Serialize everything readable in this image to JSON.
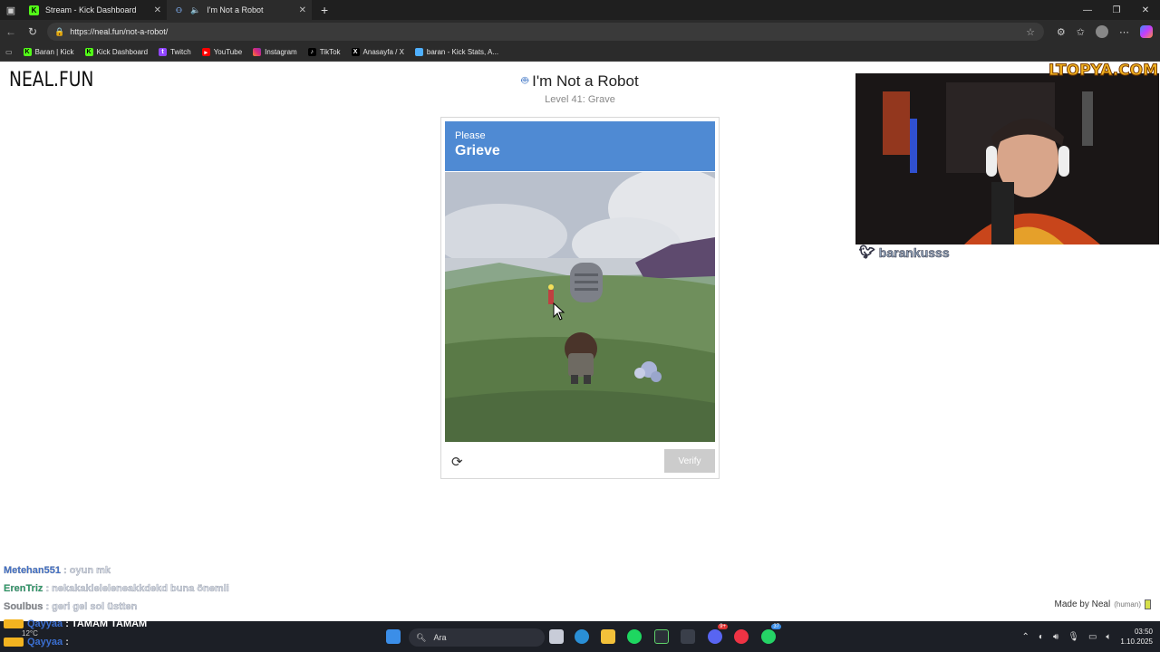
{
  "browser": {
    "tabs": [
      {
        "title": "Stream - Kick Dashboard",
        "active": false
      },
      {
        "title": "I'm Not a Robot",
        "active": true
      }
    ],
    "url": "https://neal.fun/not-a-robot/",
    "bookmarks": [
      "Baran | Kick",
      "Kick Dashboard",
      "Twitch",
      "YouTube",
      "Instagram",
      "TikTok",
      "Anasayfa / X",
      "baran - Kick Stats, A..."
    ]
  },
  "page": {
    "logo": "NEAL.FUN",
    "title": "I'm Not a Robot",
    "subtitle": "Level 41: Grave",
    "captcha": {
      "please": "Please",
      "word": "Grieve",
      "verify_label": "Verify"
    },
    "made_by": "Made by Neal",
    "made_by_tag": "(human)"
  },
  "overlay": {
    "brand": "LTOPYA.COM",
    "twitter_handle": "barankusss",
    "chat": [
      {
        "user": "Metehan551",
        "message": " : oyun mk",
        "user_color": "#3b6fd1"
      },
      {
        "user": "ErenTriz",
        "message": " : nekakakleleleneakkdekd buna önemli",
        "user_color": "#25a060"
      },
      {
        "user": "Soulbus",
        "message": " : geri gel sol üstten",
        "user_color": "#888888"
      },
      {
        "user": "Qayyaa",
        "message": " : TAMAM TAMAM",
        "user_color": "#3b6fd1"
      },
      {
        "user": "Qayyaa",
        "message": " : ",
        "user_color": "#3b6fd1"
      }
    ]
  },
  "taskbar": {
    "search_placeholder": "Ara",
    "weather_temp": "12°C",
    "time": "03:50",
    "date": "1.10.2025",
    "badge_discord": "9+",
    "badge_whatsapp": "37"
  }
}
